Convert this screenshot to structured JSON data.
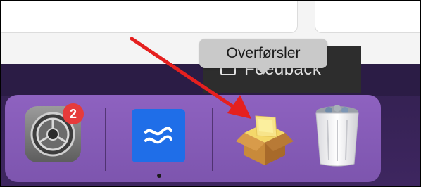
{
  "tooltip": {
    "label": "Overførsler"
  },
  "feedback": {
    "label": "Feedback",
    "icon": "chat-bubble-icon"
  },
  "dock": {
    "items": [
      {
        "name": "settings",
        "icon": "gear-icon",
        "badge": "2"
      },
      {
        "name": "app",
        "icon": "waves-icon",
        "running": true
      },
      {
        "name": "downloads",
        "icon": "package-icon"
      },
      {
        "name": "trash",
        "icon": "trash-icon"
      }
    ]
  },
  "colors": {
    "arrow": "#e5201f",
    "dock": "#8660b8",
    "tooltip": "#c9c9c9",
    "badge": "#e63b3b",
    "app_icon": "#1f6ee8"
  }
}
